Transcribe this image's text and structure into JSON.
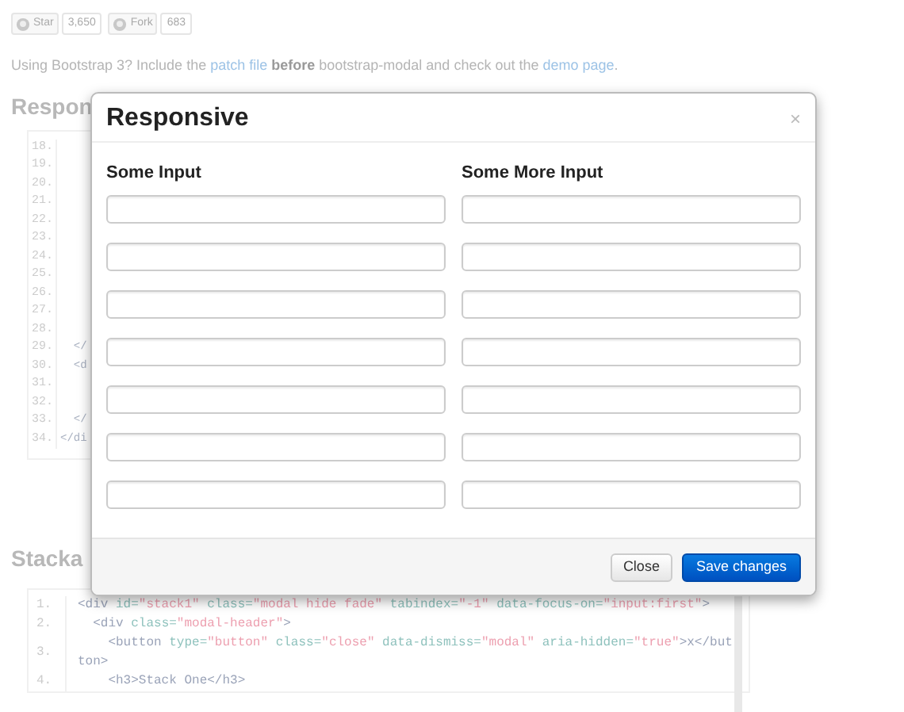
{
  "github_buttons": [
    {
      "label": "Star",
      "count": "3,650"
    },
    {
      "label": "Fork",
      "count": "683"
    }
  ],
  "intro": [
    {
      "kind": "text",
      "text": "Using Bootstrap 3? Include the "
    },
    {
      "kind": "link",
      "text": "patch file"
    },
    {
      "kind": "text",
      "text": " **before** bootstrap-modal and check out the "
    },
    {
      "kind": "link",
      "text": "demo page"
    },
    {
      "kind": "text",
      "text": "."
    }
  ],
  "section_1": {
    "heading": "Respon",
    "code": [
      {
        "number": "18."
      },
      {
        "number": "19."
      },
      {
        "number": "20."
      },
      {
        "number": "21."
      },
      {
        "number": "22."
      },
      {
        "number": "23."
      },
      {
        "number": "24."
      },
      {
        "number": "25."
      },
      {
        "number": "26."
      },
      {
        "number": "27."
      },
      {
        "number": "28."
      },
      {
        "number": "29.",
        "code": "  </"
      },
      {
        "number": "30.",
        "code": "  <d"
      },
      {
        "number": "31."
      },
      {
        "number": "32."
      },
      {
        "number": "33.",
        "code": "  </"
      },
      {
        "number": "34.",
        "code": "</di"
      }
    ]
  },
  "section_2": {
    "heading": "Stacka",
    "code": [
      {
        "number": "1.",
        "segments": [
          {
            "kind": "tag",
            "text": "<div"
          },
          {
            "kind": "attr",
            "text": " id="
          },
          {
            "kind": "value",
            "text": "\"stack1\""
          },
          {
            "kind": "attr",
            "text": " class="
          },
          {
            "kind": "value",
            "text": "\"modal hide fade\""
          },
          {
            "kind": "attr",
            "text": " tabindex="
          },
          {
            "kind": "value",
            "text": "\"-1\""
          },
          {
            "kind": "attr",
            "text": " data-focus-on="
          },
          {
            "kind": "value",
            "text": "\"input:first\""
          },
          {
            "kind": "tag",
            "text": ">"
          }
        ]
      },
      {
        "number": "2.",
        "segments": [
          {
            "kind": "tag",
            "text": "  <div"
          },
          {
            "kind": "attr",
            "text": " class="
          },
          {
            "kind": "value",
            "text": "\"modal-header\""
          },
          {
            "kind": "tag",
            "text": ">"
          }
        ]
      },
      {
        "number": "3.",
        "segments": [
          {
            "kind": "tag",
            "text": "    <button"
          },
          {
            "kind": "attr",
            "text": " type="
          },
          {
            "kind": "value",
            "text": "\"button\""
          },
          {
            "kind": "attr",
            "text": " class="
          },
          {
            "kind": "value",
            "text": "\"close\""
          },
          {
            "kind": "attr",
            "text": " data-dismiss="
          },
          {
            "kind": "value",
            "text": "\"modal\""
          },
          {
            "kind": "attr",
            "text": " aria-hidden="
          },
          {
            "kind": "value",
            "text": "\"true\""
          },
          {
            "kind": "tag",
            "text": ">x</button>"
          }
        ]
      },
      {
        "number": "4.",
        "segments": [
          {
            "kind": "tag",
            "text": "    <h3>Stack One</h3>"
          }
        ]
      }
    ]
  },
  "modal": {
    "title": "Responsive",
    "close": "×",
    "columns": [
      {
        "label": "Some Input"
      },
      {
        "label": "Some More Input"
      }
    ],
    "buttons": [
      {
        "label": "Close",
        "kind": "default"
      },
      {
        "label": "Save changes",
        "kind": "primary"
      }
    ]
  }
}
